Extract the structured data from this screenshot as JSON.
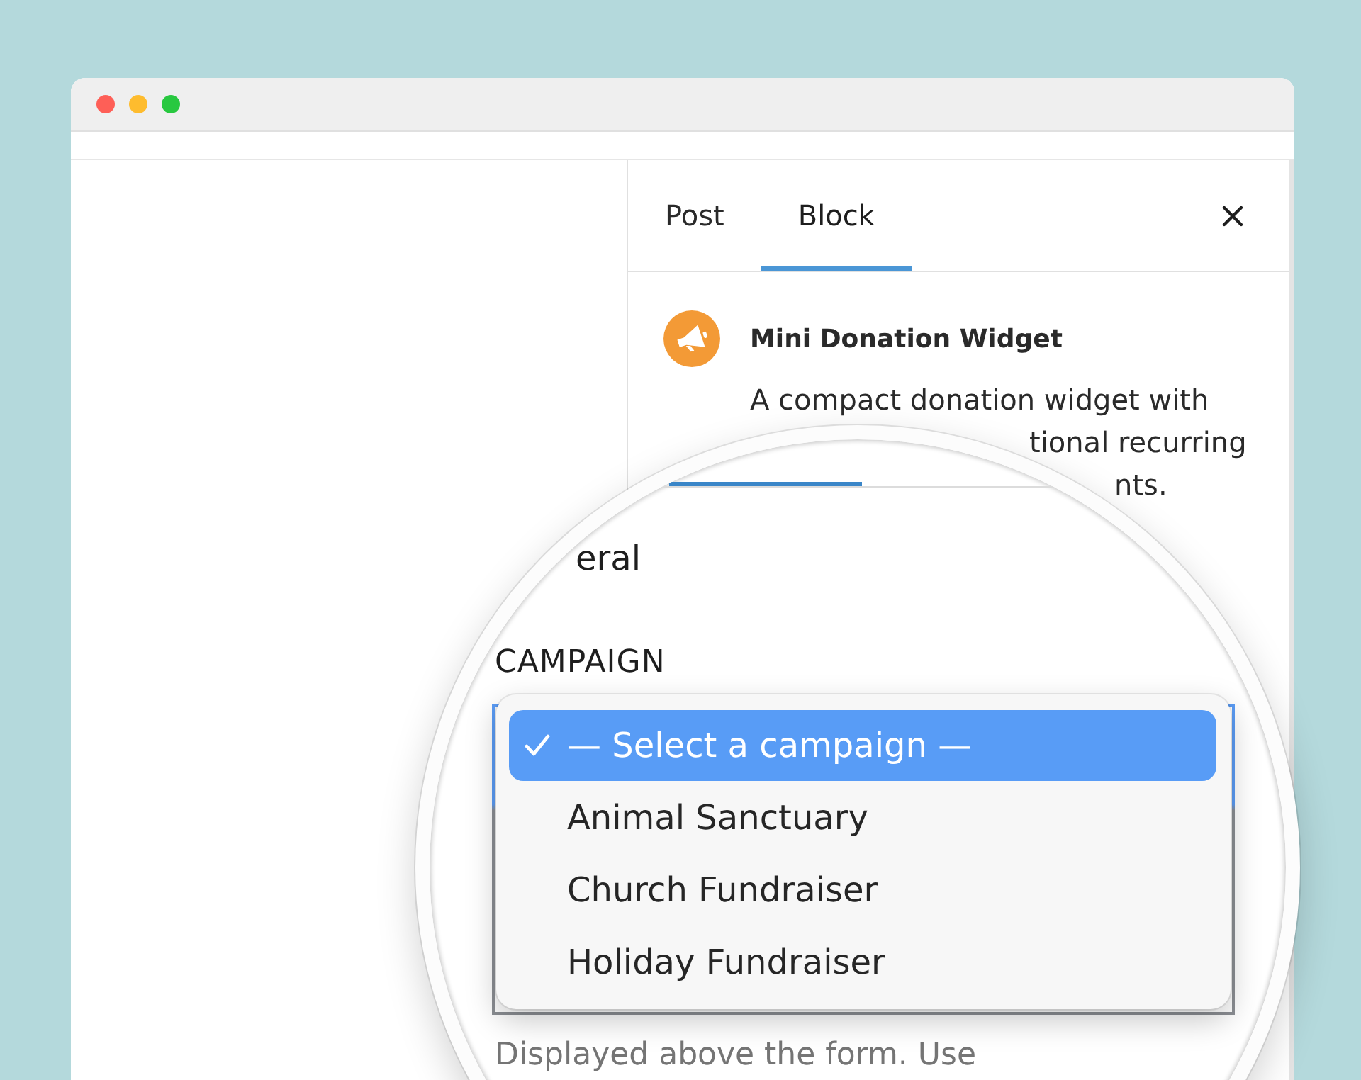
{
  "sidebar": {
    "tabs": [
      {
        "label": "Post",
        "selected": false
      },
      {
        "label": "Block",
        "selected": true
      }
    ],
    "block": {
      "title": "Mini Donation Widget",
      "description_fragments": [
        "A compact donation widget with",
        "tional recurring",
        "nts."
      ]
    }
  },
  "magnifier": {
    "section_title": "eral",
    "field_label": "CAMPAIGN",
    "campaign_menu": {
      "options": [
        {
          "label": "— Select a campaign —",
          "selected": true
        },
        {
          "label": "Animal Sanctuary",
          "selected": false
        },
        {
          "label": "Church Fundraiser",
          "selected": false
        },
        {
          "label": "Holiday Fundraiser",
          "selected": false
        }
      ]
    },
    "help_text": "Displayed above the form. Use"
  }
}
